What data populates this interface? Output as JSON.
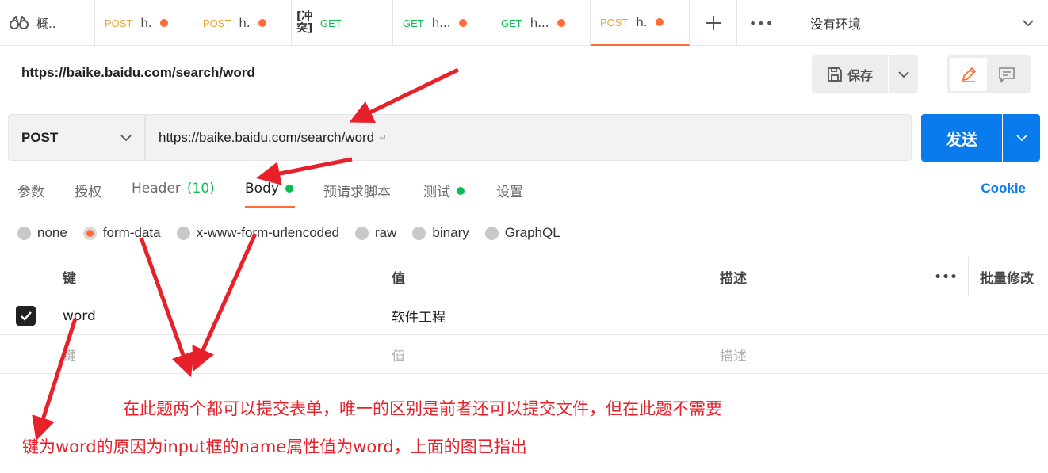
{
  "tabs": {
    "overview_label": "概..",
    "items": [
      {
        "method": "POST",
        "title": "h.",
        "dirty": true
      },
      {
        "method": "POST",
        "title": "h.",
        "dirty": true
      },
      {
        "conflict": "[冲突]",
        "method": "GET",
        "title": "",
        "dirty": false
      },
      {
        "method": "GET",
        "title": "h...",
        "dirty": true
      },
      {
        "method": "GET",
        "title": "h...",
        "dirty": true
      },
      {
        "method": "POST",
        "title": "h.",
        "dirty": true
      }
    ],
    "more_glyph": "•••",
    "environment": "没有环境"
  },
  "request": {
    "name": "https://baike.baidu.com/search/word",
    "save_label": "保存",
    "method": "POST",
    "url": "https://baike.baidu.com/search/word",
    "send_label": "发送"
  },
  "subtabs": {
    "params": "参数",
    "auth": "授权",
    "headers": "Header",
    "headers_count": "(10)",
    "body": "Body",
    "prerequest": "预请求脚本",
    "tests": "测试",
    "settings": "设置",
    "cookie": "Cookie"
  },
  "body_types": [
    "none",
    "form-data",
    "x-www-form-urlencoded",
    "raw",
    "binary",
    "GraphQL"
  ],
  "body_selected": "form-data",
  "table": {
    "headers": {
      "key": "键",
      "value": "值",
      "description": "描述",
      "more": "•••",
      "bulk_edit": "批量修改"
    },
    "rows": [
      {
        "checked": true,
        "key": "word",
        "value": "软件工程",
        "description": ""
      }
    ],
    "placeholder": {
      "key": "键",
      "value": "值",
      "description": "描述"
    }
  },
  "annotations": {
    "note1": "在此题两个都可以提交表单，唯一的区别是前者还可以提交文件，但在此题不需要",
    "note2": "键为word的原因为input框的name属性值为word，上面的图已指出"
  },
  "colors": {
    "accent": "#ff6c37",
    "send": "#097bed",
    "get": "#0cbb52",
    "post": "#e8a33d",
    "annotation": "#e8202a"
  },
  "icons": {
    "overview": "binoculars-icon",
    "save": "save-icon",
    "edit": "pencil-icon",
    "comment": "comment-icon",
    "checkbox": "check-icon"
  }
}
